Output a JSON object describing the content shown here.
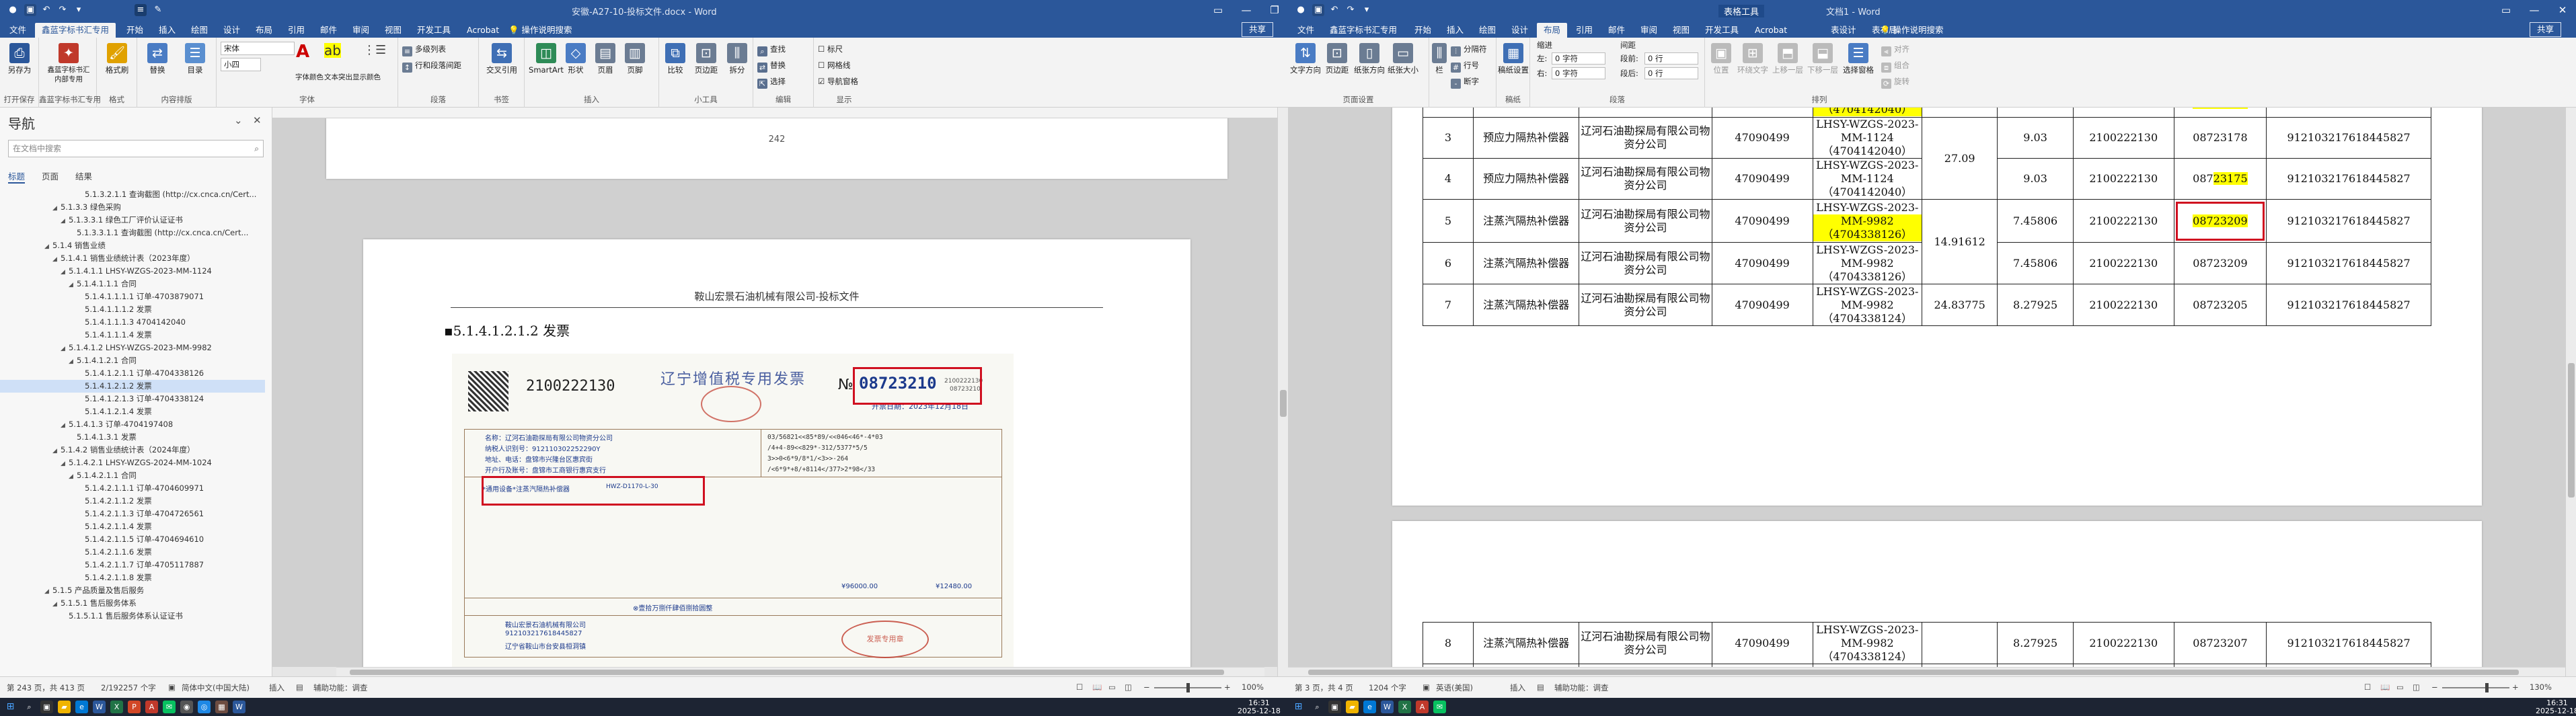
{
  "left": {
    "title": "安徽-A27-10-投标文件.docx - Word",
    "share": "共享",
    "tabs": [
      "文件",
      "鑫蓝字标书汇专用",
      "开始",
      "插入",
      "绘图",
      "设计",
      "布局",
      "引用",
      "邮件",
      "审阅",
      "视图",
      "开发工具",
      "Acrobat"
    ],
    "active_tab": "鑫蓝字标书汇专用",
    "tell_me": "操作说明搜索",
    "ribbon": {
      "groups": [
        "打开保存",
        "鑫蓝字标书汇专用",
        "格式",
        "内容排版",
        "字体",
        "段落",
        "书签",
        "插入",
        "小工具",
        "编辑",
        "显示"
      ],
      "buttons": [
        "另存为",
        "鑫蓝字标书汇内部专用",
        "格式刷",
        "替换",
        "目录",
        "字体颜色",
        "文本突出显示颜色",
        "多级列表",
        "行和段落间距",
        "交叉引用",
        "SmartArt",
        "形状",
        "页眉",
        "页脚",
        "比较",
        "页边距",
        "拆分",
        "查找",
        "替换",
        "选择",
        "标尺",
        "网格线",
        "导航窗格"
      ],
      "font_name": "宋体",
      "font_size": "小四"
    },
    "nav": {
      "title": "导航",
      "search_placeholder": "在文档中搜索",
      "tabs": [
        "标题",
        "页面",
        "结果"
      ],
      "items": [
        {
          "text": "5.1.3.2.1.1 查询截图 (http://cx.cnca.cn/Cert...",
          "level": 8,
          "exp": ""
        },
        {
          "text": "5.1.3.3 绿色采购",
          "level": 5,
          "exp": "◢"
        },
        {
          "text": "5.1.3.3.1 绿色工厂评价认证证书",
          "level": 6,
          "exp": "◢"
        },
        {
          "text": "5.1.3.3.1.1 查询截图 (http://cx.cnca.cn/Cert...",
          "level": 7,
          "exp": ""
        },
        {
          "text": "5.1.4 销售业绩",
          "level": 4,
          "exp": "◢"
        },
        {
          "text": "5.1.4.1 销售业绩统计表（2023年度）",
          "level": 5,
          "exp": "◢"
        },
        {
          "text": "5.1.4.1.1 LHSY-WZGS-2023-MM-1124",
          "level": 6,
          "exp": "◢"
        },
        {
          "text": "5.1.4.1.1.1 合同",
          "level": 7,
          "exp": "◢"
        },
        {
          "text": "5.1.4.1.1.1.1 订单-4703879071",
          "level": 8,
          "exp": ""
        },
        {
          "text": "5.1.4.1.1.1.2 发票",
          "level": 8,
          "exp": ""
        },
        {
          "text": "5.1.4.1.1.1.3 4704142040",
          "level": 8,
          "exp": ""
        },
        {
          "text": "5.1.4.1.1.1.4 发票",
          "level": 8,
          "exp": ""
        },
        {
          "text": "5.1.4.1.2 LHSY-WZGS-2023-MM-9982",
          "level": 6,
          "exp": "◢"
        },
        {
          "text": "5.1.4.1.2.1 合同",
          "level": 7,
          "exp": "◢"
        },
        {
          "text": "5.1.4.1.2.1.1 订单-4704338126",
          "level": 8,
          "exp": ""
        },
        {
          "text": "5.1.4.1.2.1.2 发票",
          "level": 8,
          "exp": "",
          "sel": true
        },
        {
          "text": "5.1.4.1.2.1.3 订单-4704338124",
          "level": 8,
          "exp": ""
        },
        {
          "text": "5.1.4.1.2.1.4 发票",
          "level": 8,
          "exp": ""
        },
        {
          "text": "5.1.4.1.3 订单-4704197408",
          "level": 6,
          "exp": "◢"
        },
        {
          "text": "5.1.4.1.3.1 发票",
          "level": 7,
          "exp": ""
        },
        {
          "text": "5.1.4.2 销售业绩统计表（2024年度）",
          "level": 5,
          "exp": "◢"
        },
        {
          "text": "5.1.4.2.1 LHSY-WZGS-2024-MM-1024",
          "level": 6,
          "exp": "◢"
        },
        {
          "text": "5.1.4.2.1.1 合同",
          "level": 7,
          "exp": "◢"
        },
        {
          "text": "5.1.4.2.1.1.1 订单-4704609971",
          "level": 8,
          "exp": ""
        },
        {
          "text": "5.1.4.2.1.1.2 发票",
          "level": 8,
          "exp": ""
        },
        {
          "text": "5.1.4.2.1.1.3 订单-4704726561",
          "level": 8,
          "exp": ""
        },
        {
          "text": "5.1.4.2.1.1.4 发票",
          "level": 8,
          "exp": ""
        },
        {
          "text": "5.1.4.2.1.1.5 订单-4704694610",
          "level": 8,
          "exp": ""
        },
        {
          "text": "5.1.4.2.1.1.6 发票",
          "level": 8,
          "exp": ""
        },
        {
          "text": "5.1.4.2.1.1.7 订单-4705117887",
          "level": 8,
          "exp": ""
        },
        {
          "text": "5.1.4.2.1.1.8 发票",
          "level": 8,
          "exp": ""
        },
        {
          "text": "5.1.5 产品质量及售后服务",
          "level": 4,
          "exp": "◢"
        },
        {
          "text": "5.1.5.1 售后服务体系",
          "level": 5,
          "exp": "◢"
        },
        {
          "text": "5.1.5.1.1 售后服务体系认证证书",
          "level": 6,
          "exp": ""
        }
      ]
    },
    "page_number_top": "242",
    "page_header": "鞍山宏景石油机械有限公司-投标文件",
    "heading": "5.1.4.1.2.1.2 发票",
    "invoice": {
      "code": "2100222130",
      "title": "辽宁增值税专用发票",
      "no_label": "№",
      "number": "08723210",
      "no_small": "2100222130",
      "no_small2": "08723210",
      "date": "开票日期：2023年12月18日",
      "buyer_name": "名称：辽河石油勘探局有限公司物资分公司",
      "buyer_id": "纳税人识别号：912110302252290Y",
      "buyer_addr": "地址、电话：盘锦市兴隆台区惠宾街",
      "buyer_bank": "开户行及账号：盘锦市工商银行惠宾支行",
      "goods": "*通用设备*注蒸汽隔热补偿器",
      "spec": "HWZ-D1170-L-30",
      "total": "¥96000.00",
      "tax": "¥12480.00",
      "total_cn": "⊗壹拾万捌仟肆佰捌拾圆整",
      "seller_name": "鞍山宏景石油机械有限公司",
      "seller_id": "912103217618445827",
      "seller_addr": "辽宁省鞍山市台安县桓洞镇",
      "stamp": "发票专用章",
      "cipher": [
        "03/56821<<85*89/<<046<46*-4*03",
        "/4+4-89<<829*-312/5377*5/5",
        "3>>0<6*9/8*1/<3>>-264",
        "/<6*9*+8/+8114</377>2*98</33"
      ]
    },
    "status": {
      "page": "第 243 页，共 413 页",
      "words": "2/192257 个字",
      "lang": "简体中文(中国大陆)",
      "insert": "插入",
      "accessibility": "辅助功能：调查",
      "zoom": "100%"
    }
  },
  "right": {
    "title": "文档1 - Word",
    "ctx_tab_title": "表格工具",
    "share": "共享",
    "tabs": [
      "文件",
      "鑫蓝字标书汇专用",
      "开始",
      "插入",
      "绘图",
      "设计",
      "布局",
      "引用",
      "邮件",
      "审阅",
      "视图",
      "开发工具",
      "Acrobat",
      "表设计",
      "表布局"
    ],
    "active_tab": "布局",
    "tell_me": "操作说明搜索",
    "ribbon": {
      "groups": [
        "页面设置",
        "稿纸",
        "段落",
        "排列"
      ],
      "buttons": [
        "文字方向",
        "页边距",
        "纸张方向",
        "纸张大小",
        "栏",
        "分隔符",
        "行号",
        "断字",
        "稿纸设置",
        "位置",
        "环绕文字",
        "上移一层",
        "下移一层",
        "选择窗格",
        "对齐",
        "组合",
        "旋转"
      ],
      "indent_left_label": "左:",
      "indent_left": "0 字符",
      "indent_right_label": "右:",
      "indent_right": "0 字符",
      "space_before_label": "段前:",
      "space_before": "0 行",
      "space_after_label": "段后:",
      "space_after": "0 行",
      "indent_label": "缩进",
      "spacing_label": "间距"
    },
    "table_top": {
      "rows": [
        {
          "idx": "2",
          "name": "补偿器",
          "company": "限公司物资分公司",
          "code": "47090499",
          "contract": [
            "MM-1124",
            "（4704142040）"
          ],
          "hl": true,
          "weight": "",
          "amount": "9.03",
          "invcode": "2100222130",
          "invno": "08723174",
          "hlno": true,
          "taxid": "912103217618445827"
        },
        {
          "idx": "3",
          "name": "预应力隔热补偿器",
          "company": "辽河石油勘探局有限公司物资分公司",
          "code": "47090499",
          "contract": [
            "LHSY-WZGS-2023-",
            "MM-1124",
            "（4704142040）"
          ],
          "hl": false,
          "weight": "27.09",
          "amount": "9.03",
          "invcode": "2100222130",
          "invno": "08723178",
          "hlno": false,
          "taxid": "912103217618445827"
        },
        {
          "idx": "4",
          "name": "预应力隔热补偿器",
          "company": "辽河石油勘探局有限公司物资分公司",
          "code": "47090499",
          "contract": [
            "LHSY-WZGS-2023-",
            "MM-1124",
            "（4704142040）"
          ],
          "hl": false,
          "weight": "",
          "amount": "9.03",
          "invcode": "2100222130",
          "invno": "08723175",
          "hlno": true,
          "taxid": "912103217618445827"
        },
        {
          "idx": "5",
          "name": "注蒸汽隔热补偿器",
          "company": "辽河石油勘探局有限公司物资分公司",
          "code": "47090499",
          "contract": [
            "LHSY-WZGS-2023-",
            "MM-9982",
            "（4704338126）"
          ],
          "hl": true,
          "weight": "14.91612",
          "amount": "7.45806",
          "invcode": "2100222130",
          "invno": "08723209",
          "hlno": true,
          "boxed": true,
          "taxid": "912103217618445827"
        },
        {
          "idx": "6",
          "name": "注蒸汽隔热补偿器",
          "company": "辽河石油勘探局有限公司物资分公司",
          "code": "47090499",
          "contract": [
            "LHSY-WZGS-2023-",
            "MM-9982",
            "（4704338126）"
          ],
          "hl": false,
          "weight": "",
          "amount": "7.45806",
          "invcode": "2100222130",
          "invno": "08723209",
          "hlno": false,
          "taxid": "912103217618445827"
        },
        {
          "idx": "7",
          "name": "注蒸汽隔热补偿器",
          "company": "辽河石油勘探局有限公司物资分公司",
          "code": "47090499",
          "contract": [
            "LHSY-WZGS-2023-",
            "MM-9982",
            "（4704338124）"
          ],
          "hl": false,
          "weight": "24.83775",
          "amount": "8.27925",
          "invcode": "2100222130",
          "invno": "08723205",
          "hlno": false,
          "taxid": "912103217618445827"
        }
      ]
    },
    "table_bottom": {
      "rows": [
        {
          "idx": "8",
          "name": "注蒸汽隔热补偿器",
          "company": "辽河石油勘探局有限公司物资分公司",
          "code": "47090499",
          "contract": [
            "LHSY-WZGS-2023-",
            "MM-9982",
            "（4704338124）"
          ],
          "amount": "8.27925",
          "invcode": "2100222130",
          "invno": "08723207",
          "taxid": "912103217618445827"
        }
      ],
      "partial": "LHSY-WZGS-2023-"
    },
    "status": {
      "page": "第 3 页，共 4 页",
      "words": "1204 个字",
      "lang": "英语(美国)",
      "insert": "插入",
      "accessibility": "辅助功能：调查",
      "zoom": "130%"
    }
  },
  "taskbar": {
    "time1": "16:31",
    "date1": "2025-12-18",
    "time2": "16:31",
    "date2": "2025-12-18"
  }
}
